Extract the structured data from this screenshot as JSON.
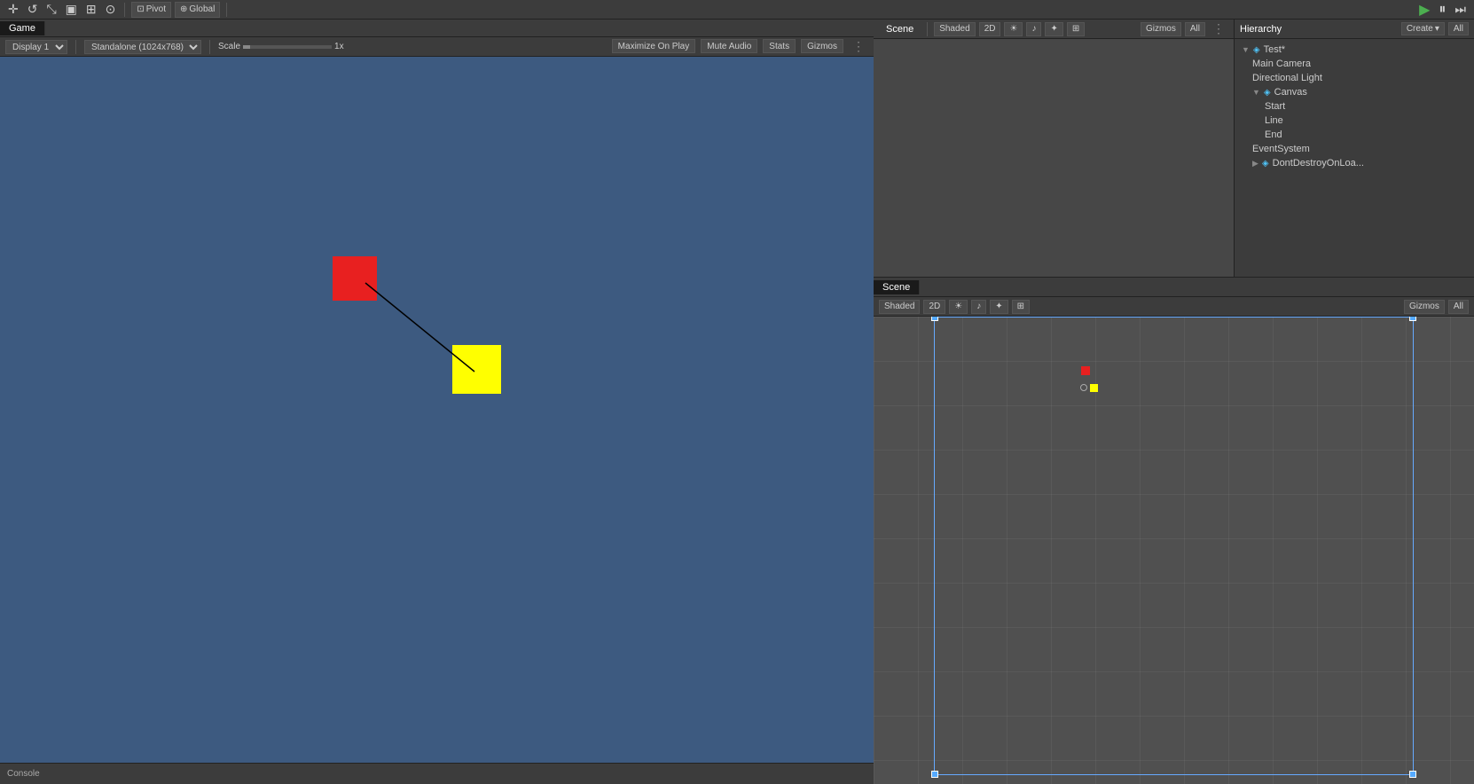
{
  "topToolbar": {
    "pivot_label": "Pivot",
    "global_label": "Global",
    "play_icon": "▶",
    "pause_icon": "⏸",
    "step_icon": "⏭"
  },
  "gamePanel": {
    "tab_label": "Game",
    "display_label": "Display 1",
    "resolution_label": "Standalone (1024x768)",
    "scale_label": "Scale",
    "scale_value": "1x",
    "maximize_label": "Maximize On Play",
    "mute_label": "Mute Audio",
    "stats_label": "Stats",
    "gizmos_label": "Gizmos"
  },
  "scenePanel": {
    "tab_label": "Scene",
    "shaded_label": "Shaded",
    "twod_label": "2D",
    "gizmos_label": "Gizmos",
    "all_label": "All"
  },
  "hierarchyPanel": {
    "title": "Hierarchy",
    "create_label": "Create",
    "all_label": "All",
    "items": [
      {
        "label": "Test*",
        "level": 0,
        "has_arrow": true,
        "expanded": true,
        "is_unity": true
      },
      {
        "label": "Main Camera",
        "level": 1,
        "has_arrow": false,
        "expanded": false,
        "is_unity": false
      },
      {
        "label": "Directional Light",
        "level": 1,
        "has_arrow": false,
        "expanded": false,
        "is_unity": false
      },
      {
        "label": "Canvas",
        "level": 1,
        "has_arrow": true,
        "expanded": true,
        "is_unity": true
      },
      {
        "label": "Start",
        "level": 2,
        "has_arrow": false,
        "expanded": false,
        "is_unity": false
      },
      {
        "label": "Line",
        "level": 2,
        "has_arrow": false,
        "expanded": false,
        "is_unity": false
      },
      {
        "label": "End",
        "level": 2,
        "has_arrow": false,
        "expanded": false,
        "is_unity": false
      },
      {
        "label": "EventSystem",
        "level": 1,
        "has_arrow": false,
        "expanded": false,
        "is_unity": false
      },
      {
        "label": "DontDestroyOnLoa...",
        "level": 1,
        "has_arrow": true,
        "expanded": false,
        "is_unity": true
      }
    ]
  },
  "console": {
    "tab_label": "Console"
  }
}
